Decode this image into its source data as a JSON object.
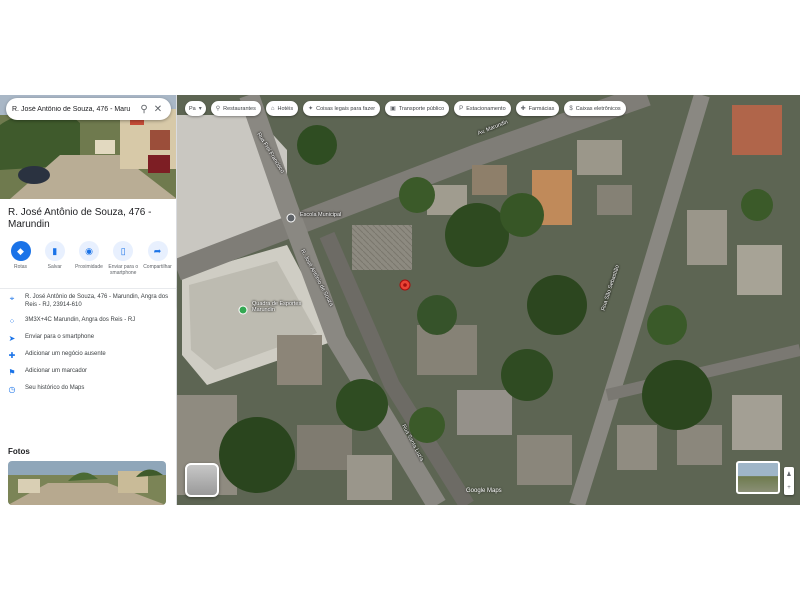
{
  "search": {
    "query": "R. José Antônio de Souza, 476 - Maru",
    "search_icon": "search-icon",
    "close_icon": "close-icon"
  },
  "place": {
    "title": "R. José Antônio de Souza, 476 - Marundin"
  },
  "actions": [
    {
      "label": "Rotas",
      "icon": "directions-icon",
      "glyph": "◆"
    },
    {
      "label": "Salvar",
      "icon": "bookmark-icon",
      "glyph": "▮"
    },
    {
      "label": "Proximidade",
      "icon": "nearby-icon",
      "glyph": "◉"
    },
    {
      "label": "Enviar para o smartphone",
      "icon": "phone-icon",
      "glyph": "▯"
    },
    {
      "label": "Compartilhar",
      "icon": "share-icon",
      "glyph": "➦"
    }
  ],
  "info": [
    {
      "icon": "location-pin-icon",
      "glyph": "⌖",
      "text": "R. José Antônio de Souza, 476 - Marundin, Angra dos Reis - RJ, 23914-610"
    },
    {
      "icon": "plus-code-icon",
      "glyph": "⁘",
      "text": "3M3X+4C Marundin, Angra dos Reis - RJ"
    },
    {
      "icon": "send-to-phone-icon",
      "glyph": "➤",
      "text": "Enviar para o smartphone"
    },
    {
      "icon": "add-business-icon",
      "glyph": "✚",
      "text": "Adicionar um negócio ausente"
    },
    {
      "icon": "add-label-icon",
      "glyph": "⚑",
      "text": "Adicionar um marcador"
    },
    {
      "icon": "history-icon",
      "glyph": "◷",
      "text": "Seu histórico do Maps"
    }
  ],
  "photos": {
    "heading": "Fotos"
  },
  "chips": [
    {
      "icon": "restaurant-icon",
      "glyph": "⚲",
      "label": "Restaurantes"
    },
    {
      "icon": "hotel-icon",
      "glyph": "⌂",
      "label": "Hotéis"
    },
    {
      "icon": "attractions-icon",
      "glyph": "✦",
      "label": "Coisas legais para fazer"
    },
    {
      "icon": "transit-icon",
      "glyph": "▣",
      "label": "Transporte público"
    },
    {
      "icon": "parking-icon",
      "glyph": "P",
      "label": "Estacionamento"
    },
    {
      "icon": "pharmacy-icon",
      "glyph": "✚",
      "label": "Farmácias"
    },
    {
      "icon": "atm-icon",
      "glyph": "$",
      "label": "Caixas eletrônicos"
    }
  ],
  "map": {
    "attribution": "Google Maps",
    "poi_label": "Quadra de Esportes",
    "poi_label2": "Marundin",
    "school_label": "Escola Municipal",
    "streets": [
      "Rua Frei Francisco",
      "Av. Marundin",
      "R. José Antônio de Souza",
      "Rua São Sebastião",
      "Rua Santa Luzia"
    ],
    "pin_color": "#ea4335"
  },
  "dropdown_label": "Pa"
}
